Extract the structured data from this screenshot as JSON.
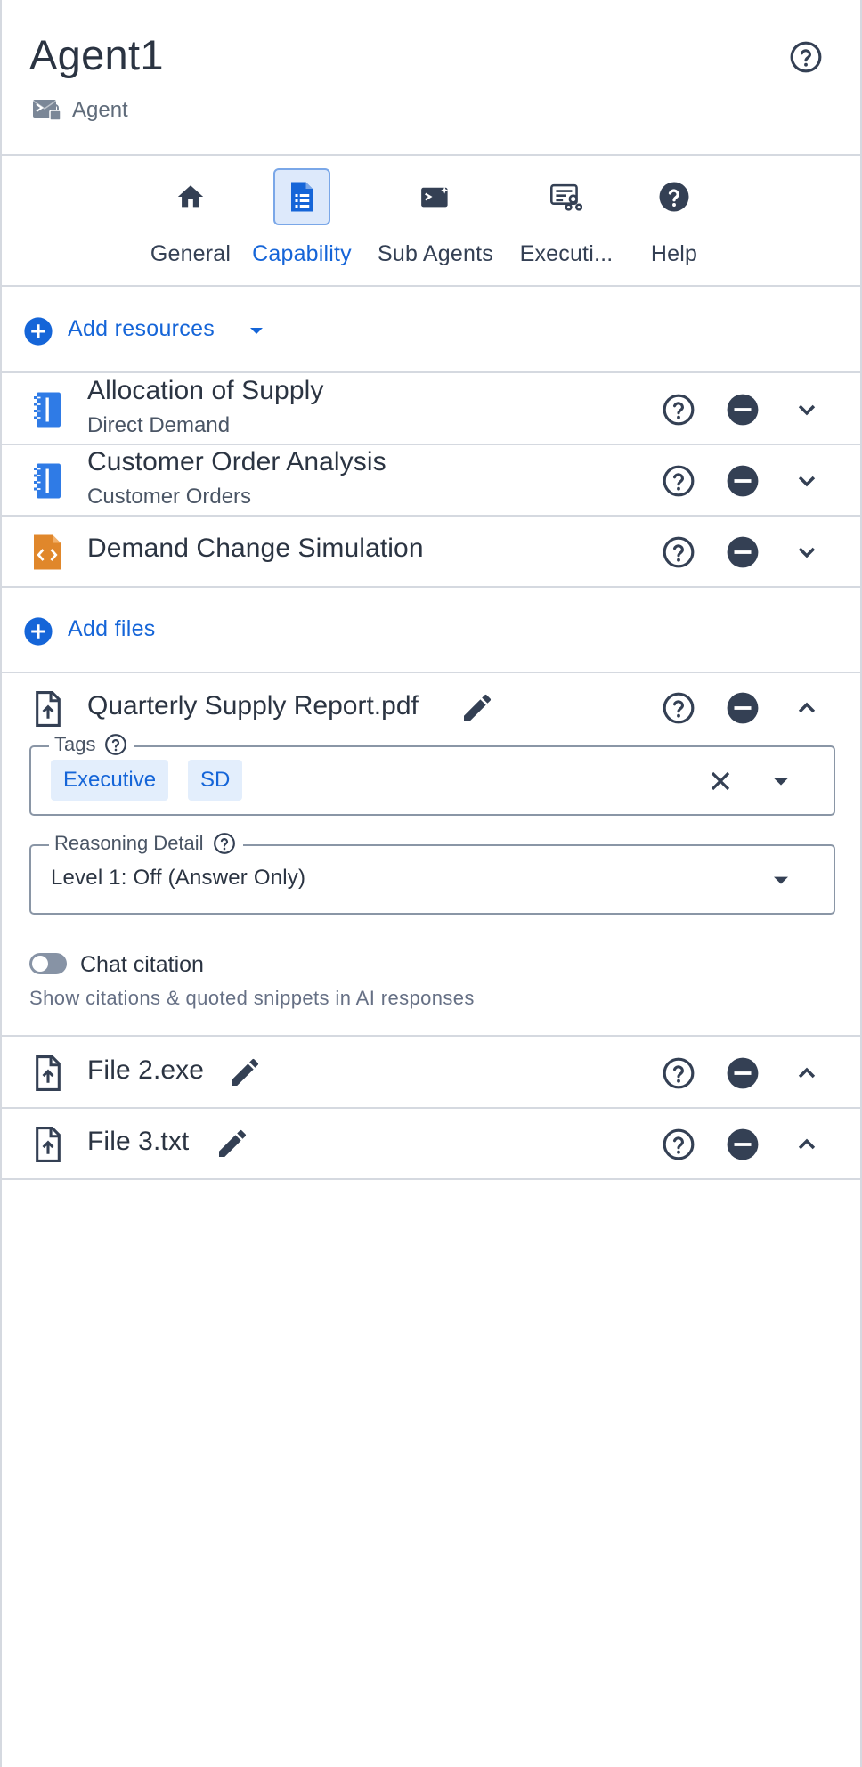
{
  "header": {
    "title": "Agent1",
    "subtitle": "Agent",
    "subtitle_icon": "agent-icon",
    "help_icon": "help-circle-icon"
  },
  "tabs": [
    {
      "label": "General",
      "icon": "home-icon",
      "active": false
    },
    {
      "label": "Capability",
      "icon": "document-list-icon",
      "active": true
    },
    {
      "label": "Sub Agents",
      "icon": "agent-icon",
      "active": false
    },
    {
      "label": "Executi...",
      "icon": "execution-icon",
      "active": false
    },
    {
      "label": "Help",
      "icon": "help-filled-icon",
      "active": false
    }
  ],
  "resources_section": {
    "add_label": "Add resources"
  },
  "resources": [
    {
      "title": "Allocation of Supply",
      "subtitle": "Direct Demand",
      "icon": "notebook-icon"
    },
    {
      "title": "Customer Order Analysis",
      "subtitle": "Customer Orders",
      "icon": "notebook-icon"
    },
    {
      "title": "Demand Change Simulation",
      "subtitle": "",
      "icon": "code-file-icon"
    }
  ],
  "files_section": {
    "add_label": "Add files"
  },
  "expanded_file": {
    "name": "Quarterly Supply Report.pdf",
    "tags_label": "Tags",
    "tags": [
      "Executive",
      "SD"
    ],
    "reasoning_label": "Reasoning Detail",
    "reasoning_value": "Level 1: Off (Answer Only)",
    "citation_label": "Chat citation",
    "citation_desc": "Show citations & quoted snippets in AI responses",
    "citation_enabled": false
  },
  "files": [
    {
      "name": "File 2.exe"
    },
    {
      "name": "File 3.txt"
    }
  ],
  "colors": {
    "accent": "#1565d8",
    "notebook": "#2f7be6",
    "code_file": "#e0872b",
    "text": "#344054",
    "border": "#d5d9e0"
  }
}
